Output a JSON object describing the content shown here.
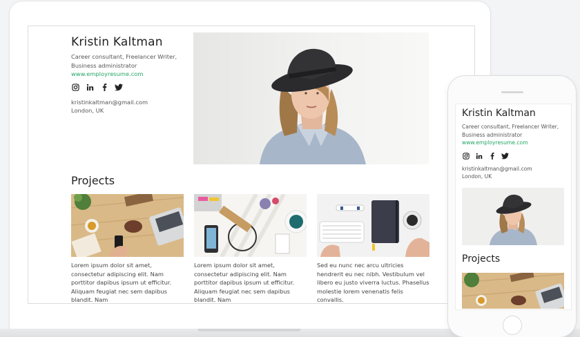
{
  "profile": {
    "name": "Kristin Kaltman",
    "role": "Career consultant, Freelancer Writer, Business administrator",
    "website": "www.employresume.com",
    "email": "kristinkaltman@gmail.com",
    "location": "London, UK"
  },
  "social_icons": [
    "instagram-icon",
    "linkedin-icon",
    "facebook-icon",
    "twitter-icon"
  ],
  "projects": {
    "title": "Projects",
    "items": [
      {
        "text": "Lorem ipsum dolor sit amet, consectetur adipiscing elit. Nam porttitor dapibus ipsum ut efficitur. Aliquam feugiat nec sem dapibus blandit. Nam"
      },
      {
        "text": "Lorem ipsum dolor sit amet, consectetur adipiscing elit. Nam porttitor dapibus ipsum ut efficitur. Aliquam feugiat nec sem dapibus blandit. Nam"
      },
      {
        "text": "Sed eu nunc nec arcu ultricies hendrerit eu nec nibh. Vestibulum vel libero eu justo viverra luctus. Phasellus molestie lorem venenatis felis convallis."
      }
    ]
  },
  "colors": {
    "link": "#23a565",
    "text": "#333333",
    "frame": "#ffffff",
    "background": "#f3f4f5"
  }
}
